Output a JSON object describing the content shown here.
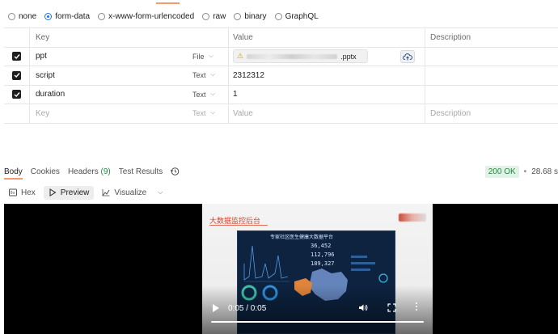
{
  "body_types": [
    {
      "label": "none",
      "selected": false
    },
    {
      "label": "form-data",
      "selected": true
    },
    {
      "label": "x-www-form-urlencoded",
      "selected": false
    },
    {
      "label": "raw",
      "selected": false
    },
    {
      "label": "binary",
      "selected": false
    },
    {
      "label": "GraphQL",
      "selected": false
    }
  ],
  "table": {
    "headers": {
      "key": "Key",
      "value": "Value",
      "description": "Description"
    },
    "rows": [
      {
        "key": "ppt",
        "type": "File",
        "value_suffix": ".pptx",
        "checked": true
      },
      {
        "key": "script",
        "type": "Text",
        "value": "2312312",
        "checked": true
      },
      {
        "key": "duration",
        "type": "Text",
        "value": "1",
        "checked": true
      }
    ],
    "empty_row": {
      "key_placeholder": "Key",
      "type": "Text",
      "value_placeholder": "Value",
      "description_placeholder": "Description"
    }
  },
  "response": {
    "tabs": {
      "body": "Body",
      "cookies": "Cookies",
      "headers": "Headers",
      "headers_count": "(9)",
      "test_results": "Test Results"
    },
    "status": "200 OK",
    "separator": "•",
    "time": "28.68 s"
  },
  "view": {
    "hex": "Hex",
    "preview": "Preview",
    "visualize": "Visualize"
  },
  "video": {
    "title": "大数据监控后台",
    "dash_title": "专家社区医生健康大数据平台",
    "dash_numbers": [
      "36,452",
      "112,796",
      "189,327"
    ],
    "time": "0:05 / 0:05",
    "progress": 1.0
  },
  "colors": {
    "accent": "#f59a6b",
    "checkbox": "#1f1f1f",
    "status_ok": "#1d8b3d",
    "radio_selected": "#1f6feb"
  }
}
